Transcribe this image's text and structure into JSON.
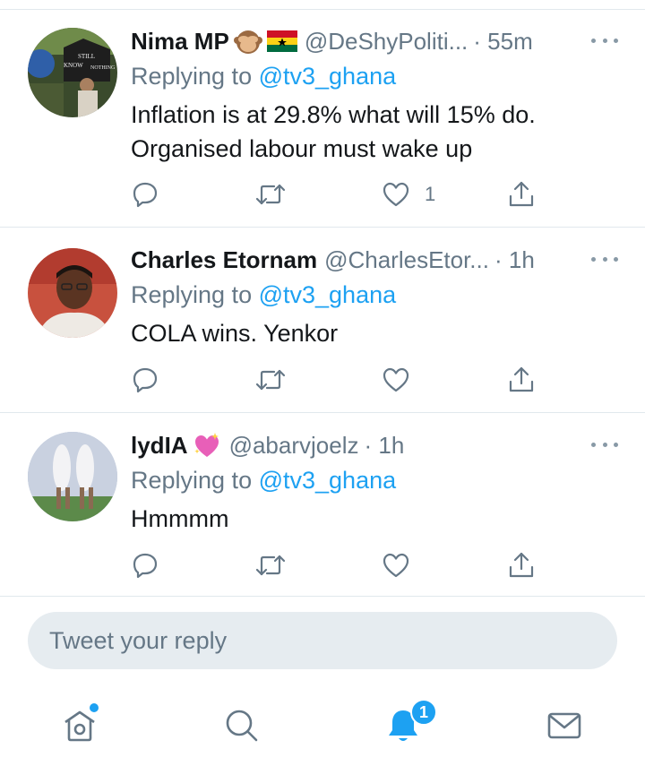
{
  "colors": {
    "accent": "#1da1f2",
    "text": "#14171a",
    "secondary": "#657786",
    "divider": "#e1e8ed",
    "compose_bg": "#e6ecf0"
  },
  "tweets": [
    {
      "name": "Nima MP",
      "name_emojis": [
        "see-no-evil-monkey",
        "ghana-flag"
      ],
      "handle": "@DeShyPoliti...",
      "time": "· 55m",
      "replying_prefix": "Replying to ",
      "replying_to": "@tv3_ghana",
      "body": "Inflation is at 29.8% what will 15% do. Organised labour must wake up",
      "like_count": "1",
      "icons": [
        "reply-icon",
        "retweet-icon",
        "like-icon",
        "share-icon",
        "more-icon"
      ]
    },
    {
      "name": "Charles Etornam",
      "handle": "@CharlesEtor...",
      "time": "· 1h",
      "replying_prefix": "Replying to ",
      "replying_to": "@tv3_ghana",
      "body": "COLA wins. Yenkor",
      "like_count": "",
      "icons": [
        "reply-icon",
        "retweet-icon",
        "like-icon",
        "share-icon",
        "more-icon"
      ]
    },
    {
      "name": "lydIA",
      "name_emojis": [
        "sparkling-heart"
      ],
      "handle": "@abarvjoelz",
      "time": "· 1h",
      "replying_prefix": "Replying to ",
      "replying_to": "@tv3_ghana",
      "body": "Hmmmm",
      "like_count": "",
      "icons": [
        "reply-icon",
        "retweet-icon",
        "like-icon",
        "share-icon",
        "more-icon"
      ]
    }
  ],
  "compose": {
    "placeholder": "Tweet your reply"
  },
  "tabbar": {
    "items": [
      "home-icon",
      "search-icon",
      "notifications-icon",
      "messages-icon"
    ],
    "notifications_badge": "1"
  }
}
